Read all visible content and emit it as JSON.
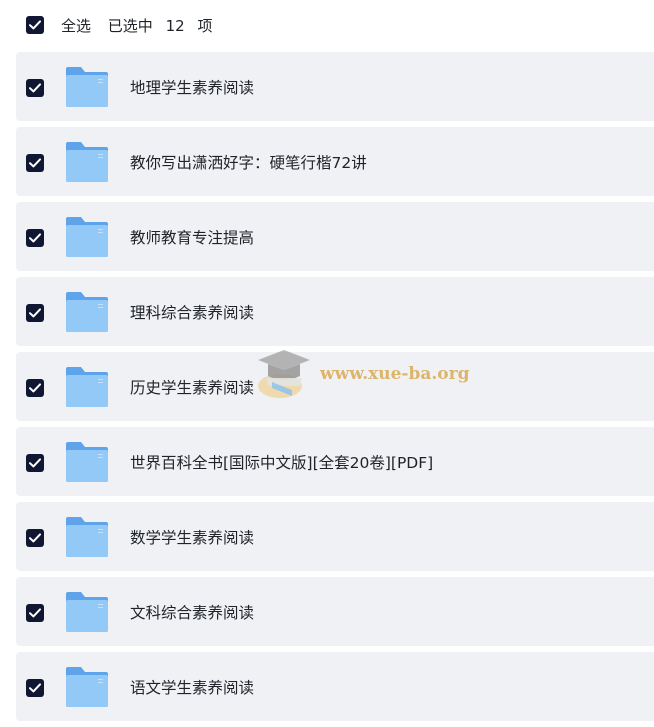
{
  "header": {
    "select_all_label": "全选",
    "selected_prefix": "已选中",
    "selected_count": "12",
    "selected_suffix": "项"
  },
  "items": [
    {
      "label": "地理学生素养阅读",
      "checked": true,
      "icon": "folder-icon"
    },
    {
      "label": "教你写出潇洒好字：硬笔行楷72讲",
      "checked": true,
      "icon": "folder-icon"
    },
    {
      "label": "教师教育专注提高",
      "checked": true,
      "icon": "folder-icon"
    },
    {
      "label": "理科综合素养阅读",
      "checked": true,
      "icon": "folder-icon"
    },
    {
      "label": "历史学生素养阅读",
      "checked": true,
      "icon": "folder-icon"
    },
    {
      "label": "世界百科全书[国际中文版][全套20卷][PDF]",
      "checked": true,
      "icon": "folder-icon"
    },
    {
      "label": "数学学生素养阅读",
      "checked": true,
      "icon": "folder-icon"
    },
    {
      "label": "文科综合素养阅读",
      "checked": true,
      "icon": "folder-icon"
    },
    {
      "label": "语文学生素养阅读",
      "checked": true,
      "icon": "folder-icon"
    }
  ],
  "watermark": {
    "text": "www.xue-ba.org"
  },
  "colors": {
    "checkbox": "#0f1733",
    "row_background": "#f0f1f4",
    "folder_blue": "#8cc4f5",
    "text": "#1f2329"
  }
}
